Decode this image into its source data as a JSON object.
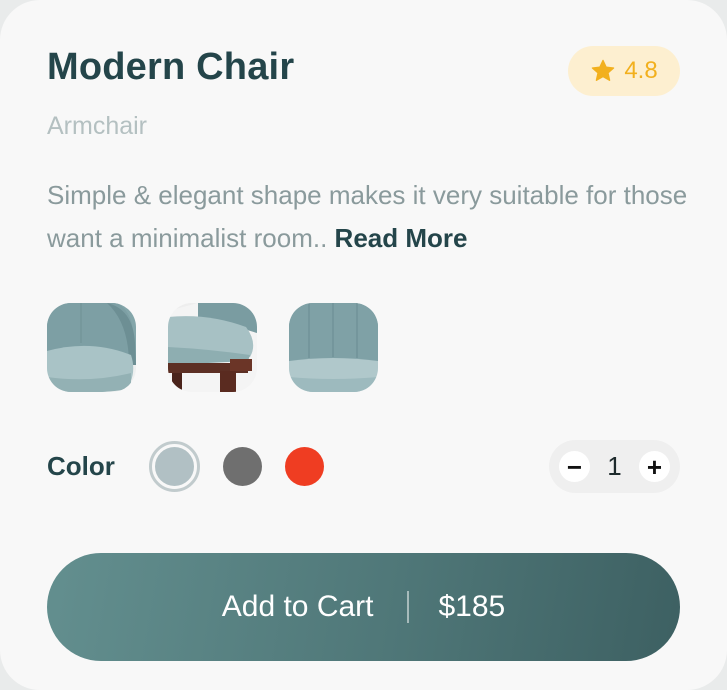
{
  "product": {
    "title": "Modern Chair",
    "category": "Armchair",
    "rating": "4.8",
    "description": "Simple & elegant shape makes it very suitable for those want a minimalist room..",
    "read_more": "Read More"
  },
  "thumbnails": [
    {
      "name": "chair-front-view"
    },
    {
      "name": "chair-side-view"
    },
    {
      "name": "chair-back-view"
    }
  ],
  "colors": {
    "label": "Color",
    "options": [
      "#b1c0c4",
      "#6f6f6f",
      "#ef3d22"
    ],
    "selected_index": 0
  },
  "quantity": {
    "minus": "−",
    "value": "1",
    "plus": "+"
  },
  "cart": {
    "label": "Add to Cart",
    "price": "$185"
  },
  "theme": {
    "primary": "#24454a",
    "accent_star": "#f2b01e",
    "button": "#4f7778"
  }
}
